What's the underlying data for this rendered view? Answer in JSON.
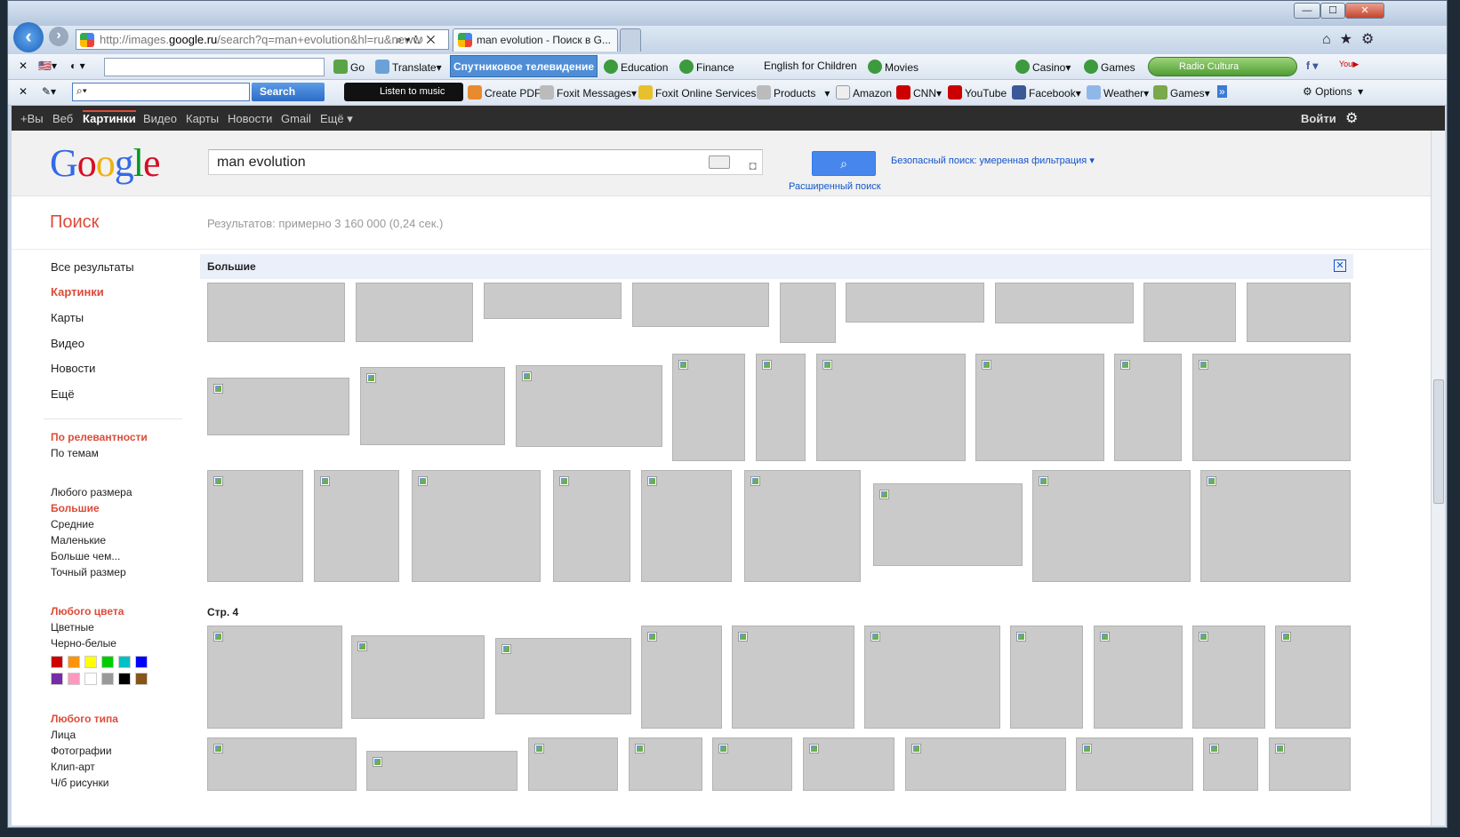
{
  "browser": {
    "url_prefix": "http://images.",
    "url_host": "google.ru",
    "url_rest": "/search?q=man+evolution&hl=ru&neww",
    "tab_title": "man evolution - Поиск в G...",
    "minimize": "—",
    "maximize": "☐",
    "close": "✕"
  },
  "toolbar1": {
    "go": "Go",
    "translate": "Translate",
    "tv": "Спутниковое телевидение",
    "education": "Education",
    "finance": "Finance",
    "english": "English for Children",
    "movies": "Movies",
    "casino": "Casino",
    "games": "Games",
    "radio": "Radio Cultura"
  },
  "toolbar2": {
    "search_btn": "Search",
    "listen": "Listen to music",
    "create_pdf": "Create PDF",
    "foxit_messages": "Foxit Messages",
    "foxit_online": "Foxit Online Services",
    "products": "Products",
    "amazon": "Amazon",
    "cnn": "CNN",
    "youtube": "YouTube",
    "facebook": "Facebook",
    "weather": "Weather",
    "games": "Games",
    "options": "Options"
  },
  "gbar": {
    "items": [
      "+Вы",
      "Веб",
      "Картинки",
      "Видео",
      "Карты",
      "Новости",
      "Gmail",
      "Ещё"
    ],
    "signin": "Войти"
  },
  "search": {
    "query": "man evolution",
    "advanced": "Расширенный поиск",
    "safe": "Безопасный поиск: умеренная фильтрация ▾",
    "section": "Поиск",
    "stats": "Результатов: примерно 3 160 000 (0,24 сек.)"
  },
  "sidebar": {
    "types": [
      "Все результаты",
      "Картинки",
      "Карты",
      "Видео",
      "Новости",
      "Ещё"
    ],
    "sort": [
      "По релевантности",
      "По темам"
    ],
    "sizes": [
      "Любого размера",
      "Большие",
      "Средние",
      "Маленькие",
      "Больше чем...",
      "Точный размер"
    ],
    "color_head": "Любого цвета",
    "colors_opts": [
      "Цветные",
      "Черно-белые"
    ],
    "swatches": [
      "#cc0000",
      "#fb940b",
      "#ffff00",
      "#00cc00",
      "#03c0c6",
      "#0000ff",
      "#762ca7",
      "#ff98bf",
      "#ffffff",
      "#999999",
      "#000000",
      "#885418"
    ],
    "type_head": "Любого типа",
    "type_opts": [
      "Лица",
      "Фотографии",
      "Клип-арт",
      "Ч/б рисунки"
    ]
  },
  "results": {
    "banner": "Большие",
    "page_label": "Стр. 4"
  }
}
